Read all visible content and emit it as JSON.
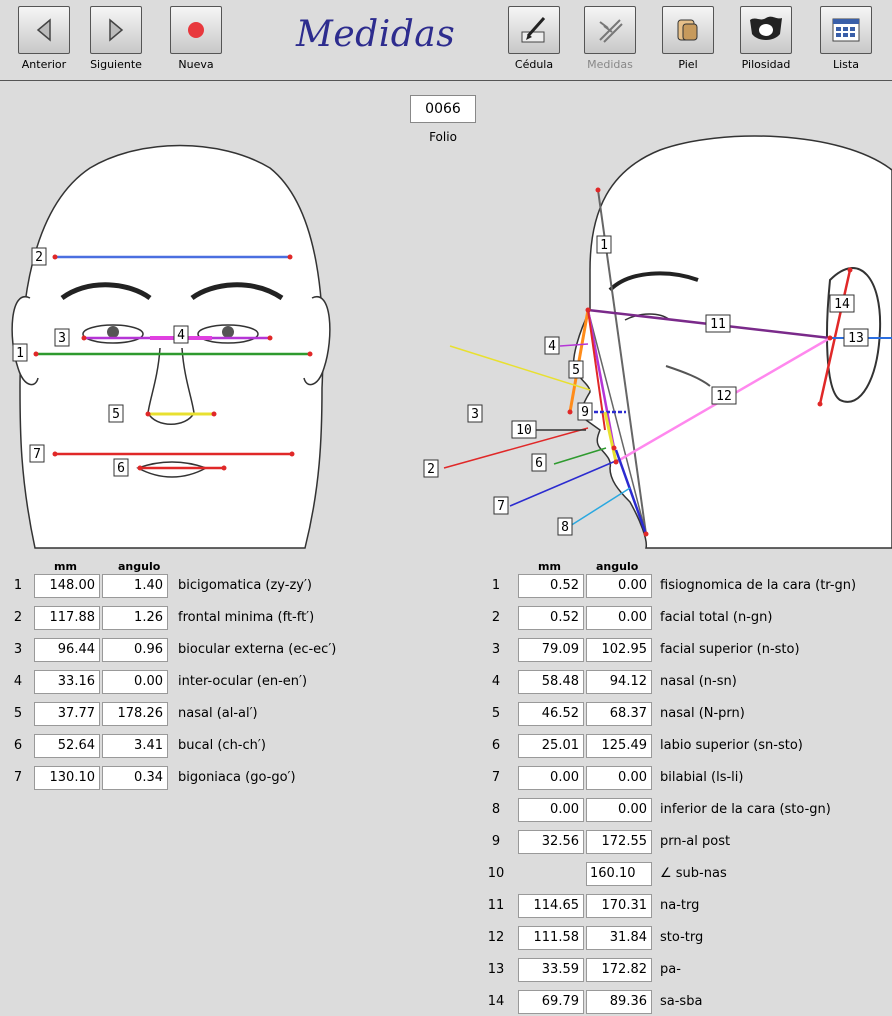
{
  "toolbar": {
    "title": "Medidas",
    "buttons": [
      {
        "label": "Anterior",
        "icon": "left-arrow-icon"
      },
      {
        "label": "Siguiente",
        "icon": "right-arrow-icon"
      },
      {
        "label": "Nueva",
        "icon": "record-dot-icon"
      },
      {
        "label": "Cédula",
        "icon": "pen-icon"
      },
      {
        "label": "Medidas",
        "icon": "caliper-icon",
        "disabled": true
      },
      {
        "label": "Piel",
        "icon": "skin-icon"
      },
      {
        "label": "Pilosidad",
        "icon": "hair-icon"
      },
      {
        "label": "Lista",
        "icon": "list-icon"
      }
    ]
  },
  "folio": {
    "value": "0066",
    "label": "Folio"
  },
  "colors": {
    "title": "#2d2c8e",
    "background": "#dcdcdc"
  },
  "front_labels": [
    "1",
    "2",
    "3",
    "4",
    "5",
    "6",
    "7"
  ],
  "side_labels": [
    "1",
    "2",
    "3",
    "4",
    "5",
    "6",
    "7",
    "8",
    "9",
    "10",
    "11",
    "12",
    "13",
    "14"
  ],
  "left_table": {
    "mm_header": "mm",
    "angle_header": "angulo",
    "rows": [
      {
        "n": "1",
        "mm": "148.00",
        "ang": "1.40",
        "desc": "bicigomatica (zy-zy′)"
      },
      {
        "n": "2",
        "mm": "117.88",
        "ang": "1.26",
        "desc": "frontal minima (ft-ft′)"
      },
      {
        "n": "3",
        "mm": "96.44",
        "ang": "0.96",
        "desc": "biocular externa (ec-ec′)"
      },
      {
        "n": "4",
        "mm": "33.16",
        "ang": "0.00",
        "desc": "inter-ocular (en-en′)"
      },
      {
        "n": "5",
        "mm": "37.77",
        "ang": "178.26",
        "desc": "nasal (al-al′)"
      },
      {
        "n": "6",
        "mm": "52.64",
        "ang": "3.41",
        "desc": "bucal (ch-ch′)"
      },
      {
        "n": "7",
        "mm": "130.10",
        "ang": "0.34",
        "desc": "bigoniaca (go-go′)"
      }
    ]
  },
  "right_table": {
    "mm_header": "mm",
    "angle_header": "angulo",
    "rows": [
      {
        "n": "1",
        "mm": "0.52",
        "ang": "0.00",
        "desc": "fisiognomica de la cara (tr-gn)"
      },
      {
        "n": "2",
        "mm": "0.52",
        "ang": "0.00",
        "desc": "facial total (n-gn)"
      },
      {
        "n": "3",
        "mm": "79.09",
        "ang": "102.95",
        "desc": "facial superior (n-sto)"
      },
      {
        "n": "4",
        "mm": "58.48",
        "ang": "94.12",
        "desc": "nasal (n-sn)"
      },
      {
        "n": "5",
        "mm": "46.52",
        "ang": "68.37",
        "desc": "nasal (N-prn)"
      },
      {
        "n": "6",
        "mm": "25.01",
        "ang": "125.49",
        "desc": "labio superior (sn-sto)"
      },
      {
        "n": "7",
        "mm": "0.00",
        "ang": "0.00",
        "desc": "bilabial (ls-li)"
      },
      {
        "n": "8",
        "mm": "0.00",
        "ang": "0.00",
        "desc": "inferior de la cara (sto-gn)"
      },
      {
        "n": "9",
        "mm": "32.56",
        "ang": "172.55",
        "desc": "prn-al post"
      },
      {
        "n": "10",
        "mm": "",
        "ang": "160.10",
        "desc": "∠ sub-nas"
      },
      {
        "n": "11",
        "mm": "114.65",
        "ang": "170.31",
        "desc": "na-trg"
      },
      {
        "n": "12",
        "mm": "111.58",
        "ang": "31.84",
        "desc": "sto-trg"
      },
      {
        "n": "13",
        "mm": "33.59",
        "ang": "172.82",
        "desc": "pa-"
      },
      {
        "n": "14",
        "mm": "69.79",
        "ang": "89.36",
        "desc": "sa-sba"
      }
    ]
  }
}
